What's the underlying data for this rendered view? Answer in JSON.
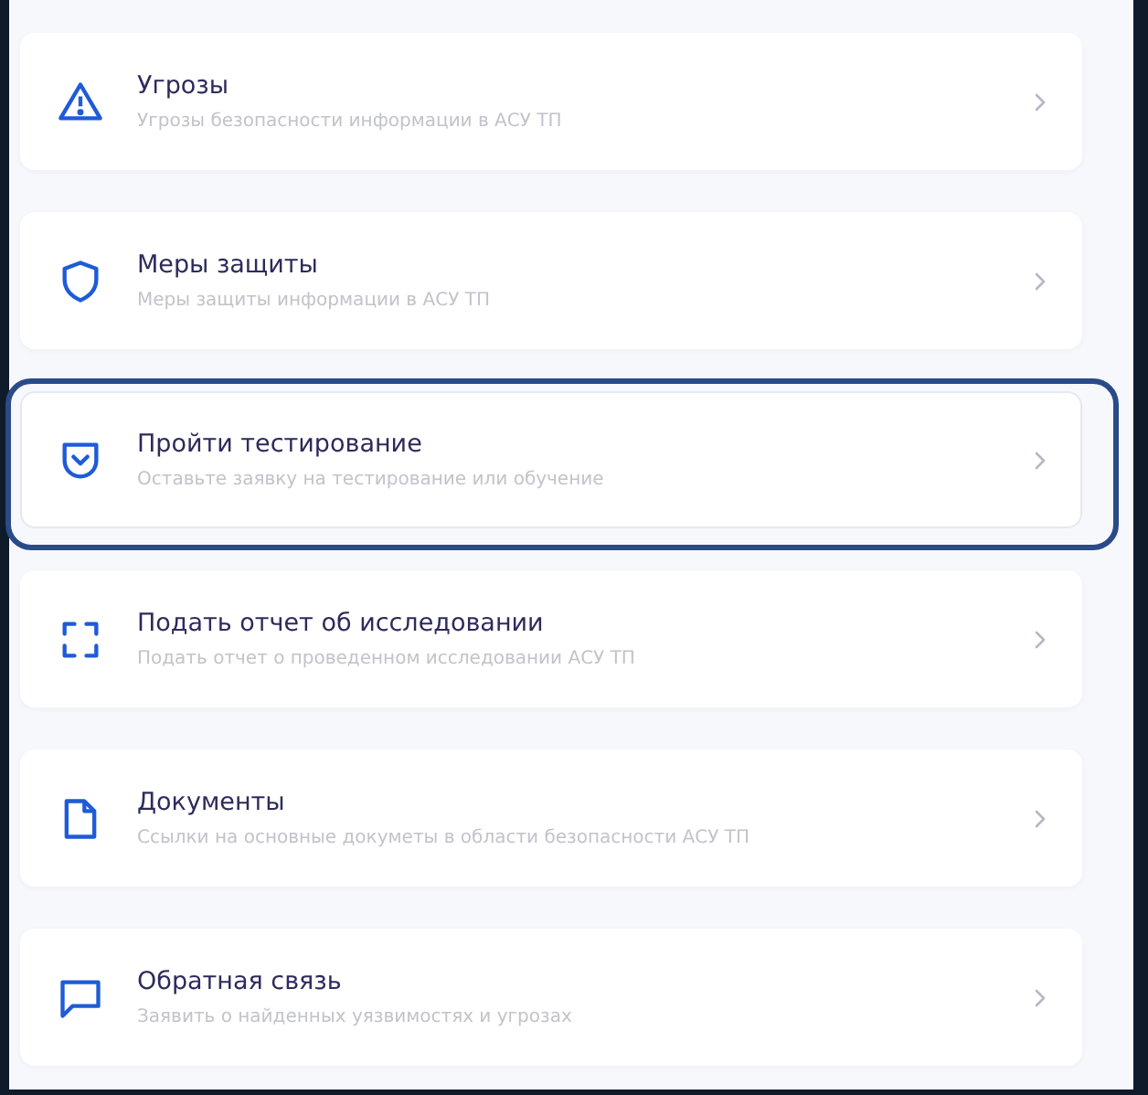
{
  "items": [
    {
      "kind": "warning",
      "title": "Угрозы",
      "subtitle": "Угрозы безопасности информации в АСУ ТП",
      "selected": false
    },
    {
      "kind": "shield",
      "title": "Меры защиты",
      "subtitle": "Меры защиты информации в АСУ ТП",
      "selected": false
    },
    {
      "kind": "pocket",
      "title": "Пройти тестирование",
      "subtitle": "Оставьте заявку на тестирование или обучение",
      "selected": true
    },
    {
      "kind": "scan",
      "title": "Подать отчет об исследовании",
      "subtitle": "Подать отчет о проведенном исследовании АСУ ТП",
      "selected": false
    },
    {
      "kind": "document",
      "title": "Документы",
      "subtitle": "Ссылки на основные докуметы в области безопасности АСУ ТП",
      "selected": false
    },
    {
      "kind": "chat",
      "title": "Обратная связь",
      "subtitle": "Заявить о найденных уязвимостях и угрозах",
      "selected": false
    }
  ]
}
